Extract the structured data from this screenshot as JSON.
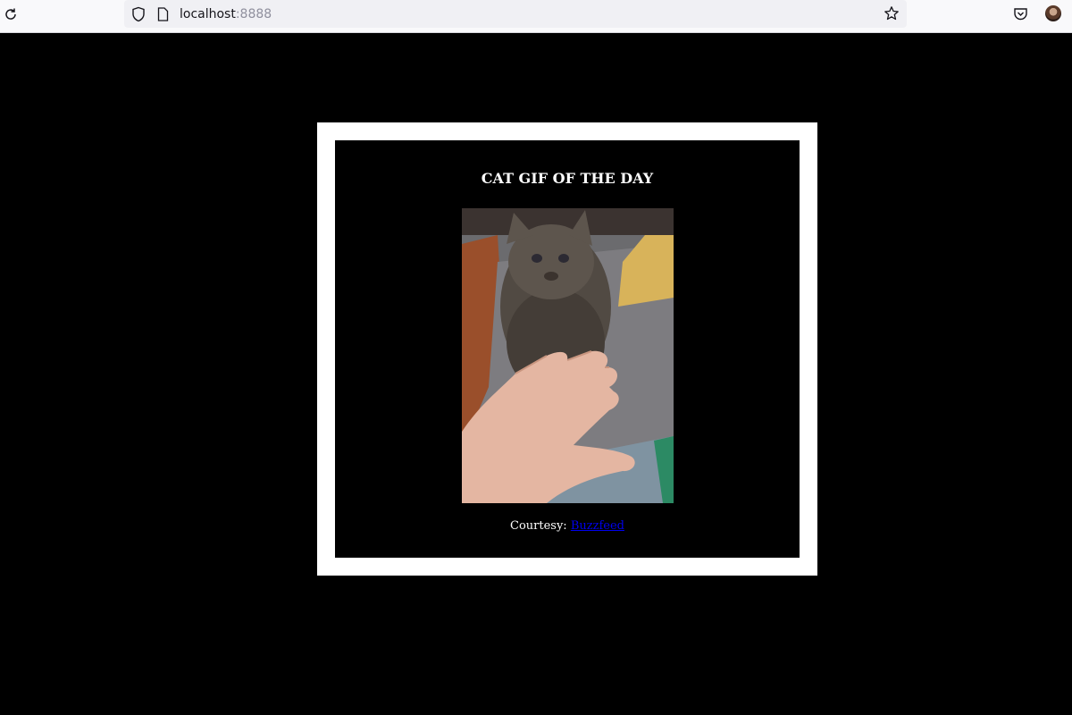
{
  "browser": {
    "url_host": "localhost",
    "url_port": ":8888",
    "icons": {
      "reload": "reload-icon",
      "shield": "shield-icon",
      "page": "page-icon",
      "bookmark": "star-icon",
      "pocket": "pocket-icon",
      "account": "avatar"
    }
  },
  "page": {
    "background": "#000000",
    "frame_color": "#ffffff",
    "title": "CAT GIF OF THE DAY",
    "caption_prefix": "Courtesy: ",
    "caption_link": "Buzzfeed",
    "link_color": "#0000ee"
  }
}
